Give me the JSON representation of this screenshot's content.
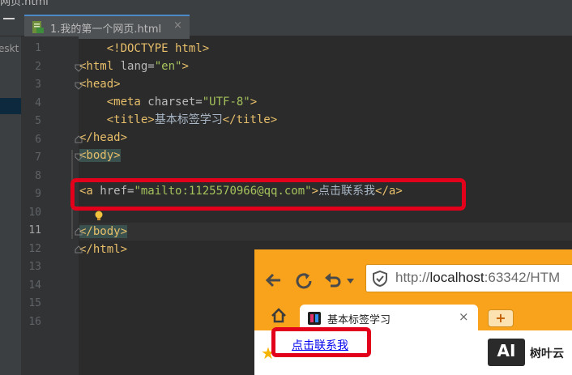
{
  "window": {
    "title_fragment": "网页.html"
  },
  "editor_tab": {
    "filename": "1.我的第一个网页.html",
    "close_glyph": "×"
  },
  "sidebar": {
    "label": "eskt"
  },
  "line_numbers": [
    "1",
    "2",
    "3",
    "4",
    "5",
    "6",
    "7",
    "8",
    "9",
    "10",
    "11",
    "12",
    "13",
    "14",
    "15",
    "16"
  ],
  "current_line": "11",
  "code": {
    "l1": {
      "tag": "<!DOCTYPE html>"
    },
    "l2": {
      "open": "<html",
      "attr": " lang=",
      "val": "\"en\"",
      "close": ">"
    },
    "l3": {
      "tag": "<head>"
    },
    "l4": {
      "open": "<meta",
      "attr": " charset=",
      "val": "\"UTF-8\"",
      "close": ">"
    },
    "l5": {
      "open": "<title>",
      "text": "基本标签学习",
      "close": "</title>"
    },
    "l6": {
      "tag": "</head>"
    },
    "l7": {
      "tag": "<body>"
    },
    "l9": {
      "open": "<a",
      "attr": " href=",
      "val": "\"mailto:1125570966@qq.com\"",
      "close": ">",
      "text": "点击联系我",
      "end": "</a>"
    },
    "l11": {
      "tag": "</body>"
    },
    "l12": {
      "tag": "</html>"
    }
  },
  "browser": {
    "url_prefix": "http://",
    "url_host": "localhost",
    "url_rest": ":63342/HTM",
    "tab_title": "基本标签学习",
    "tab_close": "×",
    "new_tab": "+",
    "page_link": "点击联系我"
  },
  "watermark": {
    "logo": "AI",
    "text": "树叶云"
  },
  "colors": {
    "tag": "#e8bf6a",
    "string": "#a5c25c",
    "attr": "#bababa",
    "highlight_box": "#e3001b",
    "browser_toolbar": "#f9a21b"
  },
  "icons": [
    "file-html-icon",
    "fold-icon",
    "lightbulb-icon",
    "back-icon",
    "reload-icon",
    "undo-icon",
    "dropdown-icon",
    "shield-icon",
    "home-icon",
    "tab-favicon-icon",
    "bookmark-star-icon"
  ]
}
